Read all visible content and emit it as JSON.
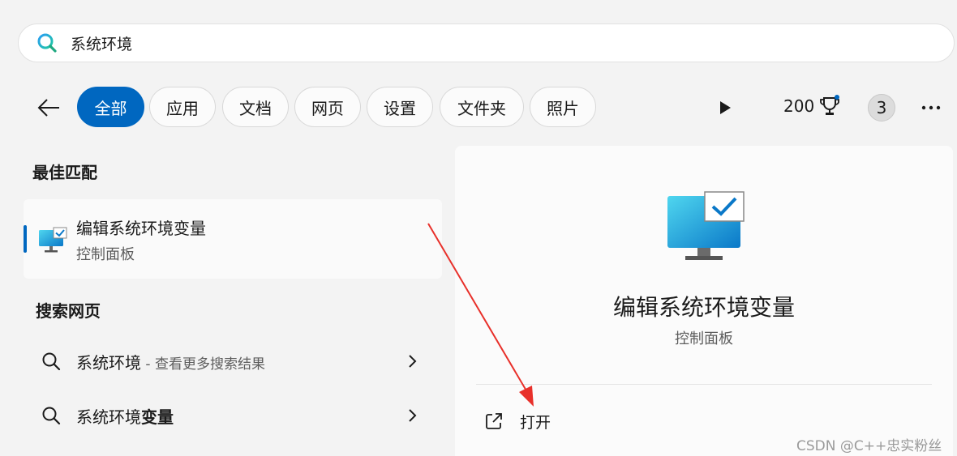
{
  "search": {
    "value": "系统环境"
  },
  "filters": [
    {
      "label": "全部",
      "active": true
    },
    {
      "label": "应用",
      "active": false
    },
    {
      "label": "文档",
      "active": false
    },
    {
      "label": "网页",
      "active": false
    },
    {
      "label": "设置",
      "active": false
    },
    {
      "label": "文件夹",
      "active": false
    },
    {
      "label": "照片",
      "active": false
    }
  ],
  "toolbar": {
    "points": "200",
    "avatar_label": "3"
  },
  "sections": {
    "best_match": "最佳匹配",
    "search_web": "搜索网页"
  },
  "best_match": {
    "name": "编辑系统环境变量",
    "subtitle": "控制面板"
  },
  "web_results": [
    {
      "query": "系统环境",
      "hint": " - 查看更多搜索结果"
    },
    {
      "query_prefix": "系统环境",
      "query_bold": "变量"
    }
  ],
  "detail": {
    "title": "编辑系统环境变量",
    "subtitle": "控制面板",
    "open_label": "打开"
  },
  "colors": {
    "accent": "#0067c0",
    "annotation_arrow": "#e8302a"
  },
  "watermark": "CSDN @C++忠实粉丝"
}
